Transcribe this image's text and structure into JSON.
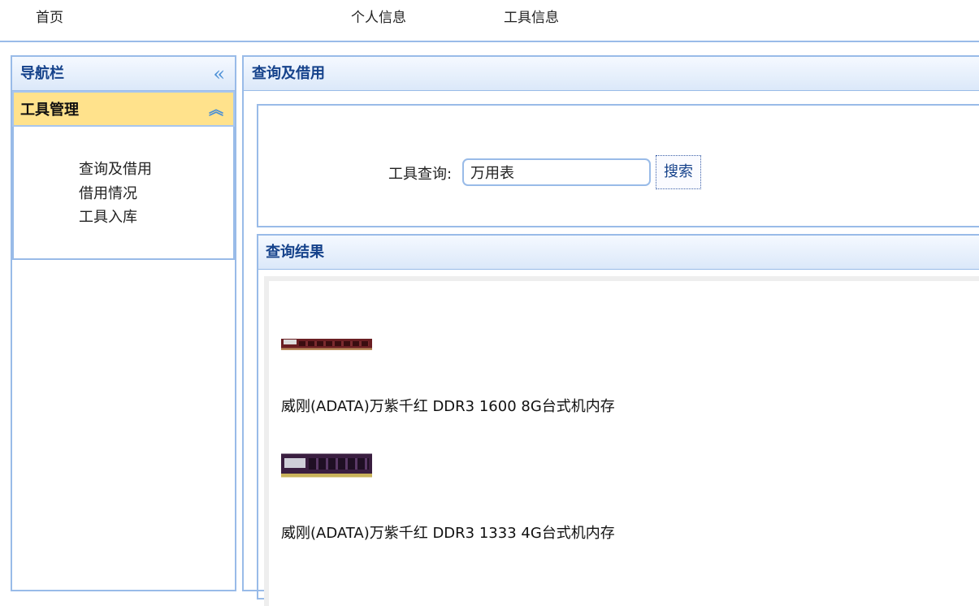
{
  "topnav": {
    "items": [
      "首页",
      "个人信息",
      "工具信息"
    ]
  },
  "sidebar": {
    "title": "导航栏",
    "collapse_icon": "double-chevron-left-icon",
    "section": {
      "title": "工具管理",
      "expand_icon": "double-chevron-up-icon",
      "items": [
        "查询及借用",
        "借用情况",
        "工具入库"
      ]
    }
  },
  "main": {
    "title": "查询及借用",
    "search": {
      "label": "工具查询:",
      "value": "万用表",
      "button": "搜索"
    },
    "results": {
      "title": "查询结果",
      "items": [
        {
          "image": "ram-stick-red",
          "name": "威刚(ADATA)万紫千红 DDR3 1600 8G台式机内存"
        },
        {
          "image": "ram-stick-purple",
          "name": "威刚(ADATA)万紫千红 DDR3 1333 4G台式机内存"
        }
      ]
    }
  },
  "colors": {
    "border": "#99bbe8",
    "header_text": "#15428b",
    "accordion_active": "#ffe28c"
  }
}
